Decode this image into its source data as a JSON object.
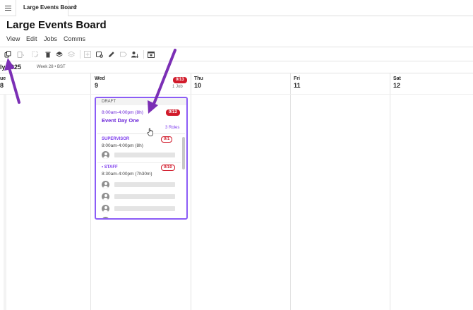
{
  "tabbar": {
    "menu_icon": "hamburger-icon",
    "tabs": [
      {
        "label": "Large Events Board"
      }
    ],
    "add_label": "+"
  },
  "header": {
    "title": "Large Events Board",
    "menu": [
      "View",
      "Edit",
      "Jobs",
      "Comms"
    ]
  },
  "toolbar": {
    "icons": [
      "copy-icon",
      "paste-dropdown-icon",
      "edit-selection-icon",
      "delete-icon",
      "layers-icon",
      "stack-icon",
      "add-shift-icon",
      "add-event-icon",
      "edit-pencil-icon",
      "tag-icon",
      "assign-user-icon",
      "calendar-icon"
    ]
  },
  "calendar": {
    "month_label": "ly 2025",
    "week_label": "Week 28 • BST",
    "days": [
      {
        "name": "ue",
        "num": "8"
      },
      {
        "name": "Wed",
        "num": "9",
        "badge": "0/13",
        "jobs": "1 Job"
      },
      {
        "name": "Thu",
        "num": "10"
      },
      {
        "name": "Fri",
        "num": "11"
      },
      {
        "name": "Sat",
        "num": "12"
      }
    ]
  },
  "event": {
    "status": "DRAFT",
    "time": "8:00am-4:00pm (8h)",
    "count": "0/13",
    "title": "Event Day One",
    "roles_label": "3 Roles",
    "roles": [
      {
        "name": "SUPERVISOR",
        "time": "8:00am-4:00pm (8h)",
        "count": "0/1",
        "slots": 1
      },
      {
        "name": "• STAFF",
        "time": "8:30am-4:00pm (7h30m)",
        "count": "0/10",
        "slots": 4
      }
    ]
  },
  "colors": {
    "accent": "#8b5cf6",
    "badge_red": "#d11a2a",
    "arrow": "#7b2fb5"
  }
}
